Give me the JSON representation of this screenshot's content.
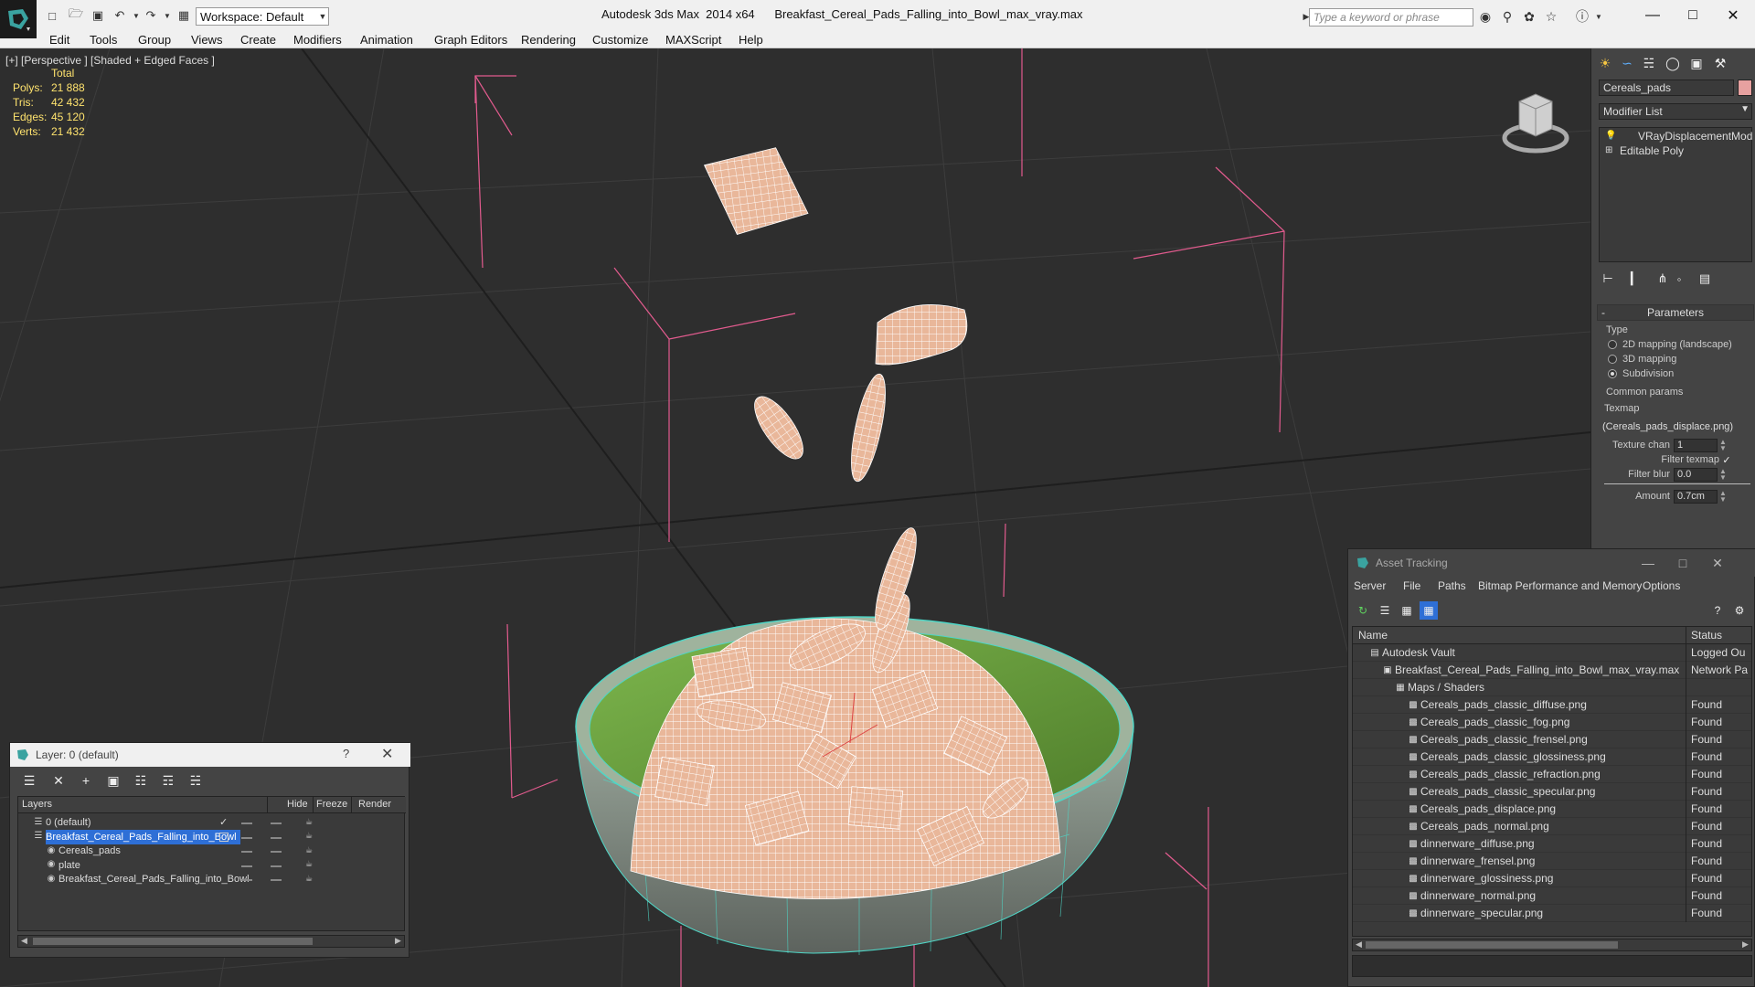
{
  "titlebar": {
    "workspace": "Workspace: Default",
    "title": "Autodesk 3ds Max  2014 x64      Breakfast_Cereal_Pads_Falling_into_Bowl_max_vray.max",
    "search_placeholder": "Type a keyword or phrase"
  },
  "menu": [
    "Edit",
    "Tools",
    "Group",
    "Views",
    "Create",
    "Modifiers",
    "Animation",
    "Graph Editors",
    "Rendering",
    "Customize",
    "MAXScript",
    "Help"
  ],
  "viewport": {
    "label": "[+] [Perspective ] [Shaded + Edged Faces ]",
    "stats": {
      "total_label": "Total",
      "rows": [
        {
          "k": "Polys:",
          "v": "21 888"
        },
        {
          "k": "Tris:",
          "v": "42 432"
        },
        {
          "k": "Edges:",
          "v": "45 120"
        },
        {
          "k": "Verts:",
          "v": "21 432"
        }
      ]
    }
  },
  "command_panel": {
    "object_name": "Cereals_pads",
    "object_color": "#e7a1a0",
    "modifier_list": "Modifier List",
    "stack": [
      "VRayDisplacementMod",
      "Editable Poly"
    ],
    "parameters_title": "Parameters",
    "type_label": "Type",
    "type_options": [
      {
        "label": "2D mapping (landscape)",
        "selected": false
      },
      {
        "label": "3D mapping",
        "selected": false
      },
      {
        "label": "Subdivision",
        "selected": true
      }
    ],
    "common_params_label": "Common params",
    "texmap_label": "Texmap",
    "texmap_value": "(Cereals_pads_displace.png)",
    "texture_chan_label": "Texture chan",
    "texture_chan_value": "1",
    "filter_texmap_label": "Filter texmap",
    "filter_blur_label": "Filter blur",
    "filter_blur_value": "0.0",
    "amount_label": "Amount",
    "amount_value": "0.7cm"
  },
  "asset_tracking": {
    "title": "Asset Tracking",
    "menu": [
      "Server",
      "File",
      "Paths",
      "Bitmap Performance and Memory",
      "Options"
    ],
    "col_name": "Name",
    "col_status": "Status",
    "rows": [
      {
        "name": "Autodesk Vault",
        "status": "Logged Ou",
        "level": 0
      },
      {
        "name": "Breakfast_Cereal_Pads_Falling_into_Bowl_max_vray.max",
        "status": "Network Pa",
        "level": 1
      },
      {
        "name": "Maps / Shaders",
        "status": "",
        "level": 2
      },
      {
        "name": "Cereals_pads_classic_diffuse.png",
        "status": "Found",
        "level": 3
      },
      {
        "name": "Cereals_pads_classic_fog.png",
        "status": "Found",
        "level": 3
      },
      {
        "name": "Cereals_pads_classic_frensel.png",
        "status": "Found",
        "level": 3
      },
      {
        "name": "Cereals_pads_classic_glossiness.png",
        "status": "Found",
        "level": 3
      },
      {
        "name": "Cereals_pads_classic_refraction.png",
        "status": "Found",
        "level": 3
      },
      {
        "name": "Cereals_pads_classic_specular.png",
        "status": "Found",
        "level": 3
      },
      {
        "name": "Cereals_pads_displace.png",
        "status": "Found",
        "level": 3
      },
      {
        "name": "Cereals_pads_normal.png",
        "status": "Found",
        "level": 3
      },
      {
        "name": "dinnerware_diffuse.png",
        "status": "Found",
        "level": 3
      },
      {
        "name": "dinnerware_frensel.png",
        "status": "Found",
        "level": 3
      },
      {
        "name": "dinnerware_glossiness.png",
        "status": "Found",
        "level": 3
      },
      {
        "name": "dinnerware_normal.png",
        "status": "Found",
        "level": 3
      },
      {
        "name": "dinnerware_specular.png",
        "status": "Found",
        "level": 3
      }
    ]
  },
  "layers": {
    "title": "Layer: 0 (default)",
    "help": "?",
    "col_layers": "Layers",
    "col_hide": "Hide",
    "col_freeze": "Freeze",
    "col_render": "Render",
    "rows": [
      {
        "name": "0 (default)",
        "level": 0,
        "selected": false,
        "current": true
      },
      {
        "name": "Breakfast_Cereal_Pads_Falling_into_Bowl",
        "level": 0,
        "selected": true,
        "current": false
      },
      {
        "name": "Cereals_pads",
        "level": 1,
        "selected": false,
        "current": false
      },
      {
        "name": "plate",
        "level": 1,
        "selected": false,
        "current": false
      },
      {
        "name": "Breakfast_Cereal_Pads_Falling_into_Bowl",
        "level": 1,
        "selected": false,
        "current": false
      }
    ]
  }
}
